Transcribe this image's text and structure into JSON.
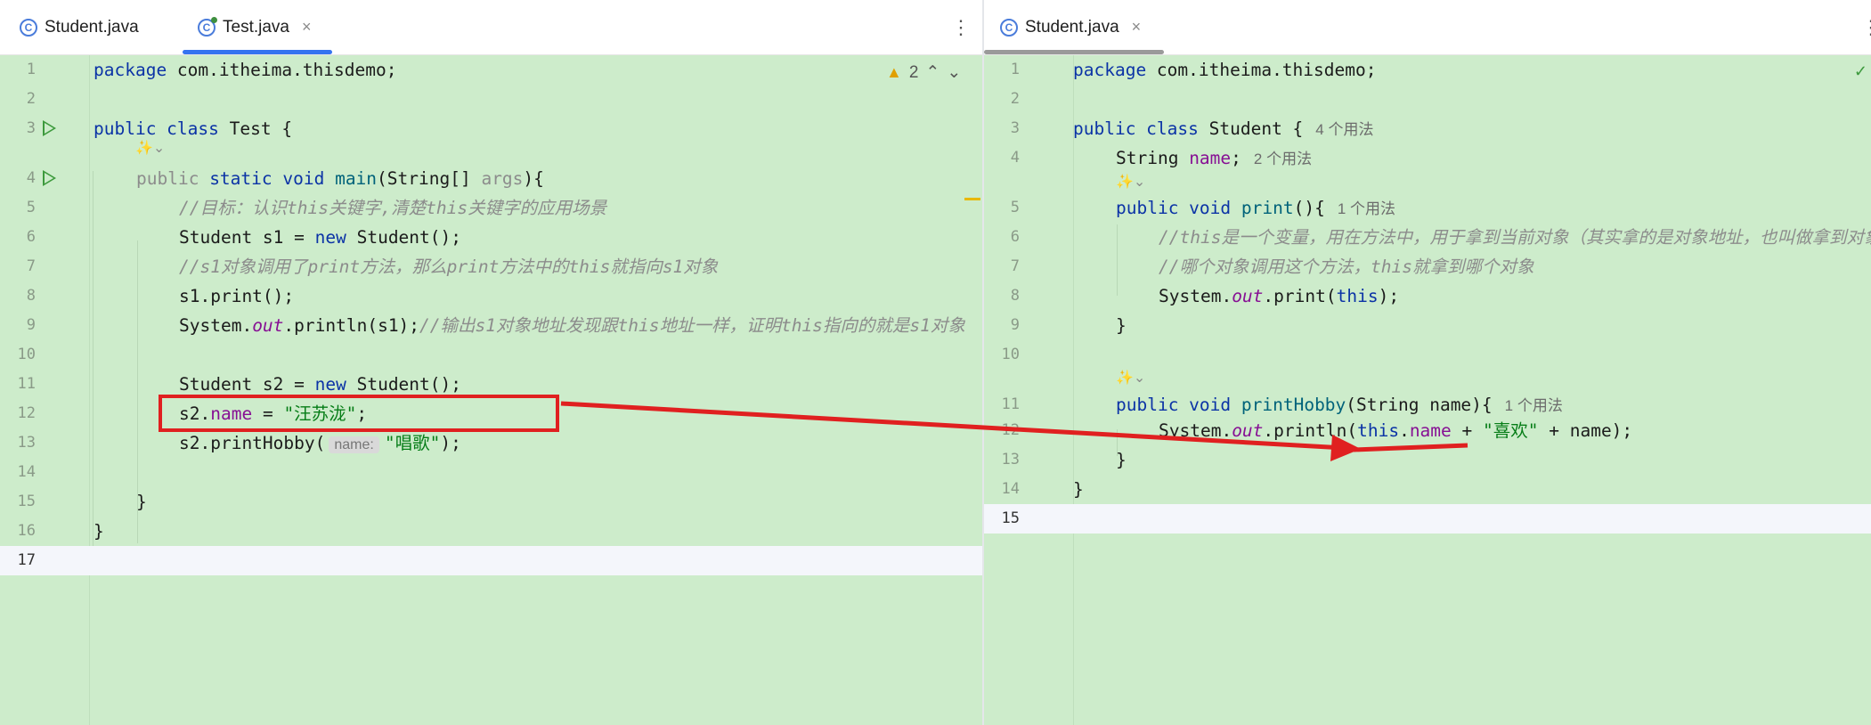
{
  "left": {
    "tabs": [
      {
        "label": "Student.java",
        "active": false
      },
      {
        "label": "Test.java",
        "active": true,
        "close": "×"
      }
    ],
    "more": "⋮",
    "warnings": {
      "count": "2",
      "up": "⌃",
      "down": "⌄"
    },
    "ai_icon": "✨⌄",
    "lines": [
      {
        "n": "1"
      },
      {
        "n": "2"
      },
      {
        "n": "3"
      },
      {
        "n": "4"
      },
      {
        "n": "5"
      },
      {
        "n": "6"
      },
      {
        "n": "7"
      },
      {
        "n": "8"
      },
      {
        "n": "9"
      },
      {
        "n": "10"
      },
      {
        "n": "11"
      },
      {
        "n": "12"
      },
      {
        "n": "13"
      },
      {
        "n": "14"
      },
      {
        "n": "15"
      },
      {
        "n": "16"
      },
      {
        "n": "17"
      }
    ],
    "code": {
      "l1_kw": "package",
      "l1_rest": " com.itheima.thisdemo;",
      "l3_kw": "public class",
      "l3_rest": " Test {",
      "l4_kw1": "public",
      "l4_kw2": " static void ",
      "l4_fn": "main",
      "l4_a": "(String[] ",
      "l4_args": "args",
      "l4_b": "){",
      "l5_cm": "//目标：认识this关键字,清楚this关键字的应用场景",
      "l6_a": "Student s1 = ",
      "l6_kw": "new",
      "l6_b": " Student();",
      "l7_cm": "//s1对象调用了print方法，那么print方法中的this就指向s1对象",
      "l8": "s1.print();",
      "l9_a": "System.",
      "l9_st": "out",
      "l9_b": ".println(s1);",
      "l9_cm": "//输出s1对象地址发现跟this地址一样，证明this指向的就是s1对象",
      "l11_a": "Student s2 = ",
      "l11_kw": "new",
      "l11_b": " Student();",
      "l12_a": "s2.",
      "l12_fld": "name",
      "l12_b": " = ",
      "l12_str": "\"汪苏泷\"",
      "l12_c": ";",
      "l13_a": "s2.printHobby(",
      "l13_inlay": "name:",
      "l13_str": "\"唱歌\"",
      "l13_b": ");",
      "l15": "}",
      "l16": "}"
    }
  },
  "right": {
    "tabs": [
      {
        "label": "Student.java",
        "active": true,
        "close": "×"
      }
    ],
    "more": "⋮",
    "check": "✓",
    "ai_icon": "✨⌄",
    "lines": [
      {
        "n": "1"
      },
      {
        "n": "2"
      },
      {
        "n": "3"
      },
      {
        "n": "4"
      },
      {
        "n": "5"
      },
      {
        "n": "6"
      },
      {
        "n": "7"
      },
      {
        "n": "8"
      },
      {
        "n": "9"
      },
      {
        "n": "10"
      },
      {
        "n": "11"
      },
      {
        "n": "12"
      },
      {
        "n": "13"
      },
      {
        "n": "14"
      },
      {
        "n": "15"
      }
    ],
    "code": {
      "l1_kw": "package",
      "l1_rest": " com.itheima.thisdemo;",
      "l3_kw": "public class",
      "l3_rest": " Student {",
      "l3_hint": "4 个用法",
      "l4_a": "String ",
      "l4_fld": "name",
      "l4_b": ";",
      "l4_hint": "2 个用法",
      "l5_kw": "public void ",
      "l5_fn": "print",
      "l5_b": "(){",
      "l5_hint": "1 个用法",
      "l6_cm": "//this是一个变量，用在方法中，用于拿到当前对象（其实拿的是对象地址，也叫做拿到对象",
      "l7_cm": "//哪个对象调用这个方法，this就拿到哪个对象",
      "l8_a": "System.",
      "l8_st": "out",
      "l8_b": ".print(",
      "l8_kw": "this",
      "l8_c": ");",
      "l9": "}",
      "l11_kw": "public void ",
      "l11_fn": "printHobby",
      "l11_b": "(String name){",
      "l11_hint": "1 个用法",
      "l12_a": "System.",
      "l12_st": "out",
      "l12_b": ".println(",
      "l12_kw": "this",
      "l12_dot": ".",
      "l12_fld": "name",
      "l12_c": " + ",
      "l12_str": "\"喜欢\"",
      "l12_d": " + name);",
      "l13": "}",
      "l14": "}"
    }
  },
  "colors": {
    "annotation": "#e02020",
    "background": "#cdeccb"
  }
}
